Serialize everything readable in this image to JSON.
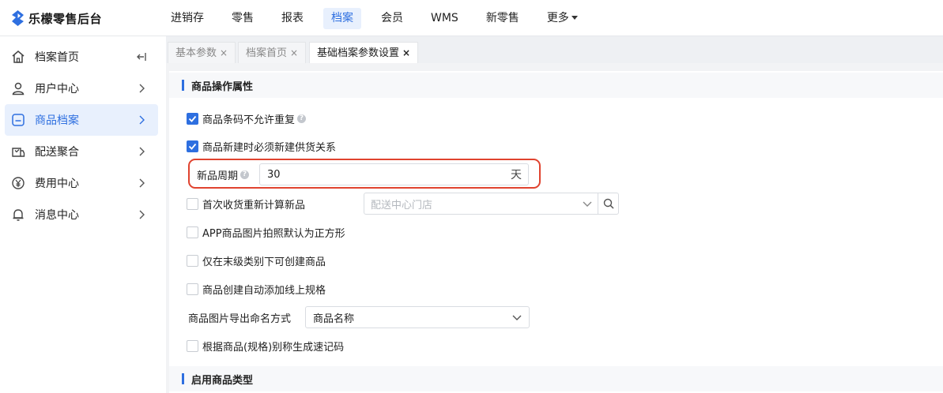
{
  "app": {
    "title": "乐檬零售后台"
  },
  "topnav": [
    {
      "label": "进销存",
      "active": false
    },
    {
      "label": "零售",
      "active": false
    },
    {
      "label": "报表",
      "active": false
    },
    {
      "label": "档案",
      "active": true
    },
    {
      "label": "会员",
      "active": false
    },
    {
      "label": "WMS",
      "active": false
    },
    {
      "label": "新零售",
      "active": false
    },
    {
      "label": "更多",
      "active": false
    }
  ],
  "sidebar": {
    "items": [
      {
        "label": "档案首页",
        "icon": "home-icon"
      },
      {
        "label": "用户中心",
        "icon": "user-icon"
      },
      {
        "label": "商品档案",
        "icon": "product-icon",
        "active": true
      },
      {
        "label": "配送聚合",
        "icon": "delivery-icon"
      },
      {
        "label": "费用中心",
        "icon": "yuan-icon"
      },
      {
        "label": "消息中心",
        "icon": "bell-icon"
      }
    ]
  },
  "tabs": [
    {
      "label": "基本参数",
      "close": "×"
    },
    {
      "label": "档案首页",
      "close": "×"
    },
    {
      "label": "基础档案参数设置",
      "close": "×",
      "active": true
    }
  ],
  "sections": {
    "s1_title": "商品操作属性",
    "s2_title": "启用商品类型"
  },
  "options": {
    "barcode_unique": {
      "label": "商品条码不允许重复",
      "checked": true
    },
    "require_supply": {
      "label": "商品新建时必须新建供货关系",
      "checked": true
    },
    "new_cycle": {
      "label": "新品周期",
      "value": "30",
      "unit": "天"
    },
    "recalc_new": {
      "label": "首次收货重新计算新品",
      "checked": false,
      "placeholder": "配送中心门店"
    },
    "app_square": {
      "label": "APP商品图片拍照默认为正方形",
      "checked": false
    },
    "leaf_only": {
      "label": "仅在末级类别下可创建商品",
      "checked": false
    },
    "auto_spec": {
      "label": "商品创建自动添加线上规格",
      "checked": false
    },
    "export_naming": {
      "label": "商品图片导出命名方式",
      "value": "商品名称"
    },
    "speed_code": {
      "label": "根据商品(规格)别称生成速记码",
      "checked": false
    }
  },
  "colors": {
    "accent": "#2e6fe0",
    "highlight": "#e0432f"
  }
}
